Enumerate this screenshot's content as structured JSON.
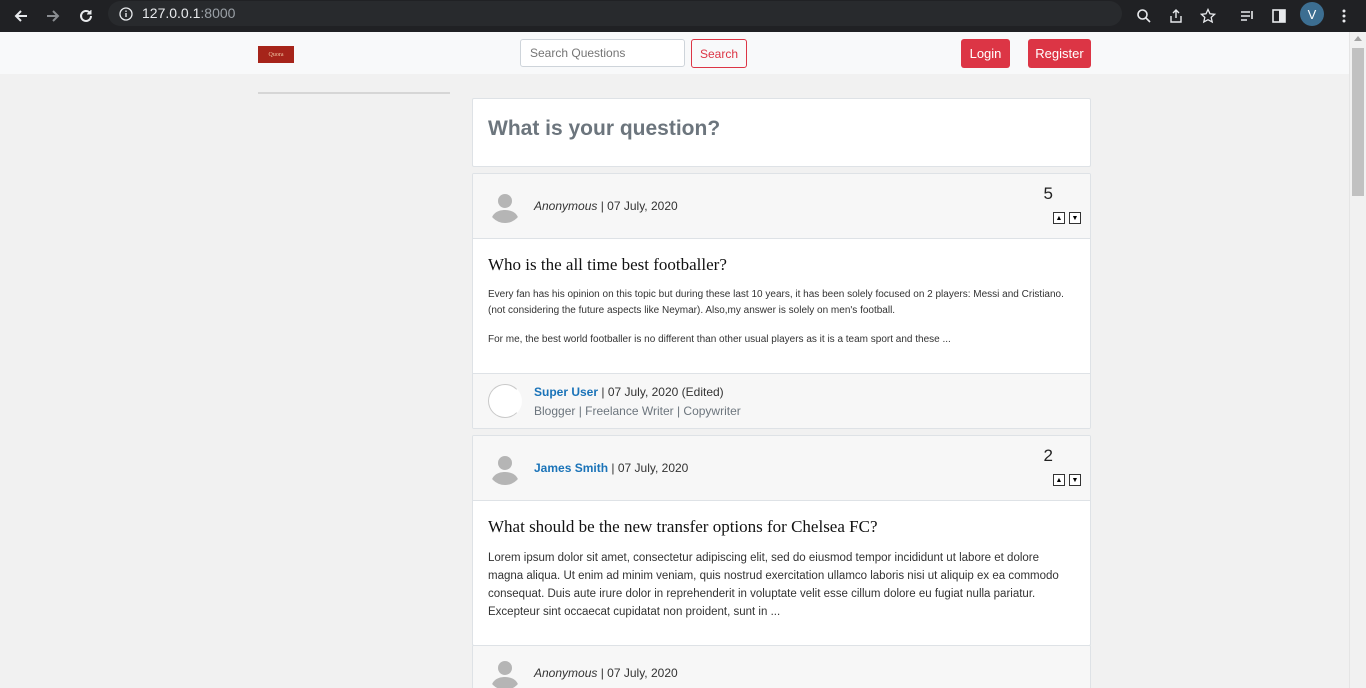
{
  "browser": {
    "url_host": "127.0.0.1",
    "url_port": ":8000",
    "profile_initial": "V",
    "icons": [
      "back-icon",
      "forward-icon",
      "reload-icon",
      "info-icon",
      "zoom-icon",
      "share-icon",
      "star-icon",
      "reading-list-icon",
      "side-panel-icon",
      "menu-icon"
    ]
  },
  "navbar": {
    "logo_text": "Quora",
    "search_placeholder": "Search Questions",
    "search_button": "Search",
    "login_button": "Login",
    "register_button": "Register"
  },
  "ask": {
    "prompt": "What is your question?"
  },
  "questions": [
    {
      "author": "Anonymous",
      "date": "| 07 July, 2020",
      "votes": "5",
      "title": "Who is the all time best footballer?",
      "paragraphs": [
        "Every fan has his opinion on this topic but during these last 10 years, it has been solely focused on 2 players: Messi and Cristiano. (not considering the future aspects like Neymar). Also,my answer is solely on men's football.",
        "For me, the best world footballer is no different than other usual players as it is a team sport and these ..."
      ],
      "answer_author": "Super User",
      "answer_date": "| 07 July, 2020 (Edited)",
      "answer_bio": "Blogger | Freelance Writer | Copywriter"
    },
    {
      "author": "James Smith",
      "date": "| 07 July, 2020",
      "votes": "2",
      "title": "What should be the new transfer options for Chelsea FC?",
      "paragraphs": [
        "Lorem ipsum dolor sit amet, consectetur adipiscing elit, sed do eiusmod tempor incididunt ut labore et dolore magna aliqua. Ut enim ad minim veniam, quis nostrud exercitation ullamco laboris nisi ut aliquip ex ea commodo consequat. Duis aute irure dolor in reprehenderit in voluptate velit esse cillum dolore eu fugiat nulla pariatur. Excepteur sint occaecat cupidatat non proident, sunt in ..."
      ]
    },
    {
      "author": "Anonymous",
      "date": "| 07 July, 2020"
    }
  ]
}
